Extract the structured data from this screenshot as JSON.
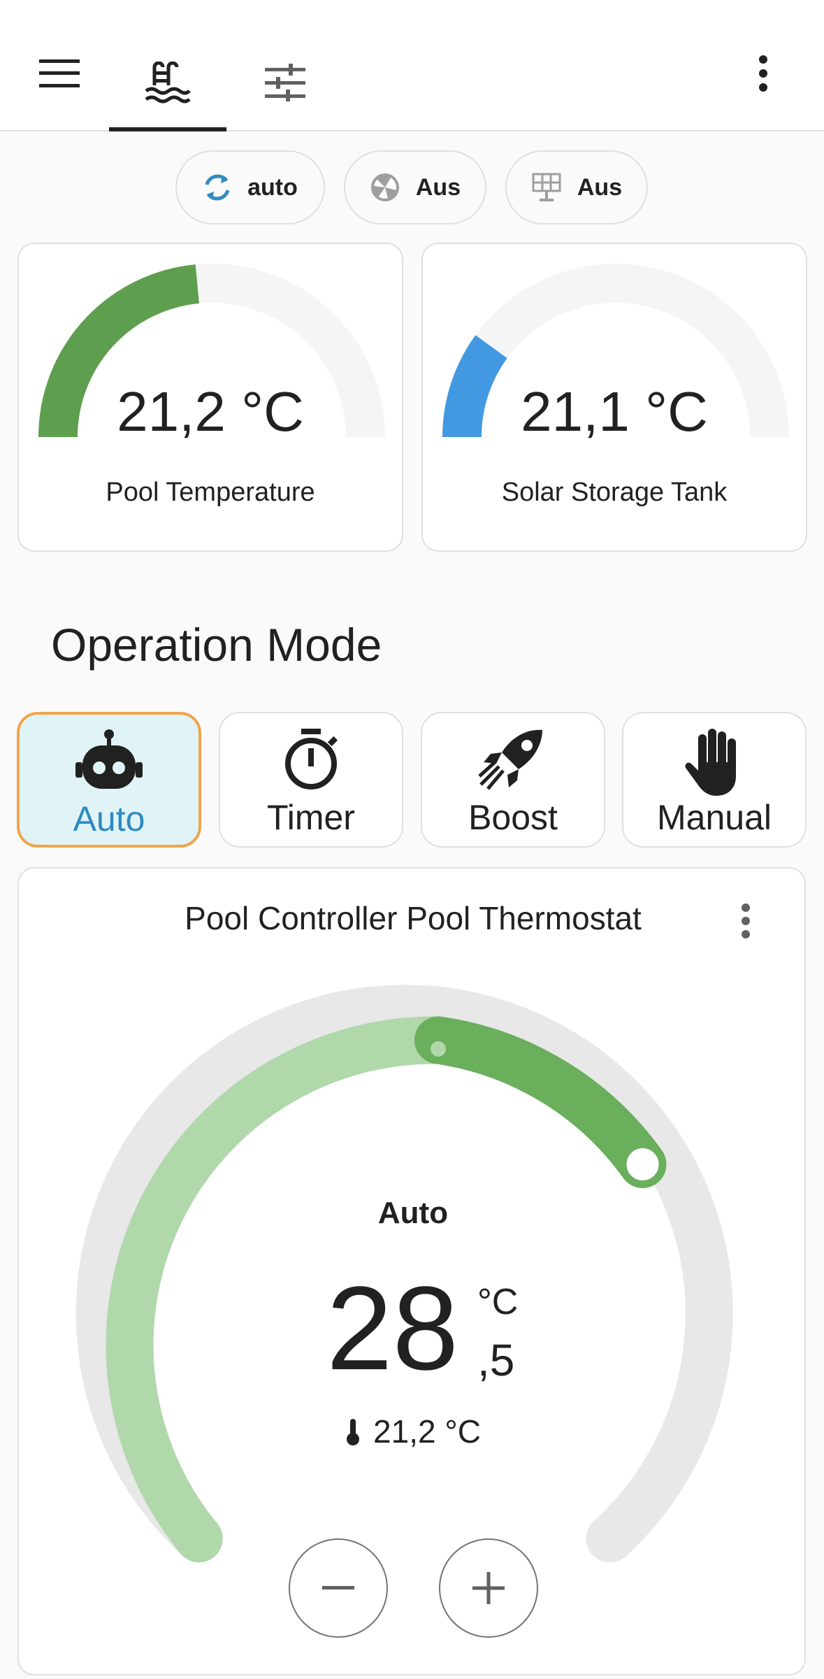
{
  "chips": [
    {
      "label": "auto",
      "icon": "sync-icon",
      "icon_color": "#2f8bc0"
    },
    {
      "label": "Aus",
      "icon": "solar-pump-icon",
      "icon_color": "#9e9e9e"
    },
    {
      "label": "Aus",
      "icon": "solar-panel-icon",
      "icon_color": "#9e9e9e"
    }
  ],
  "gauges": [
    {
      "value_text": "21,2 °C",
      "name": "Pool Temperature",
      "color": "#5e9e4f",
      "fill_fraction": 0.47
    },
    {
      "value_text": "21,1 °C",
      "name": "Solar Storage Tank",
      "color": "#4299e1",
      "fill_fraction": 0.2
    }
  ],
  "section_title": "Operation Mode",
  "modes": [
    {
      "label": "Auto",
      "icon": "robot-icon",
      "active": true
    },
    {
      "label": "Timer",
      "icon": "timer-icon",
      "active": false
    },
    {
      "label": "Boost",
      "icon": "rocket-icon",
      "active": false
    },
    {
      "label": "Manual",
      "icon": "hand-icon",
      "active": false
    }
  ],
  "thermostat": {
    "title": "Pool Controller Pool Thermostat",
    "mode": "Auto",
    "target_int": "28",
    "target_dec": ",5",
    "unit": "°C",
    "current": "21,2 °C",
    "accent": "#6aaf5c",
    "accent_light": "#b0d8ab"
  },
  "colors": {
    "active_mode_bg": "#e0f4f8",
    "active_mode_border": "#f0a44a",
    "active_mode_text": "#2f8bc0"
  }
}
